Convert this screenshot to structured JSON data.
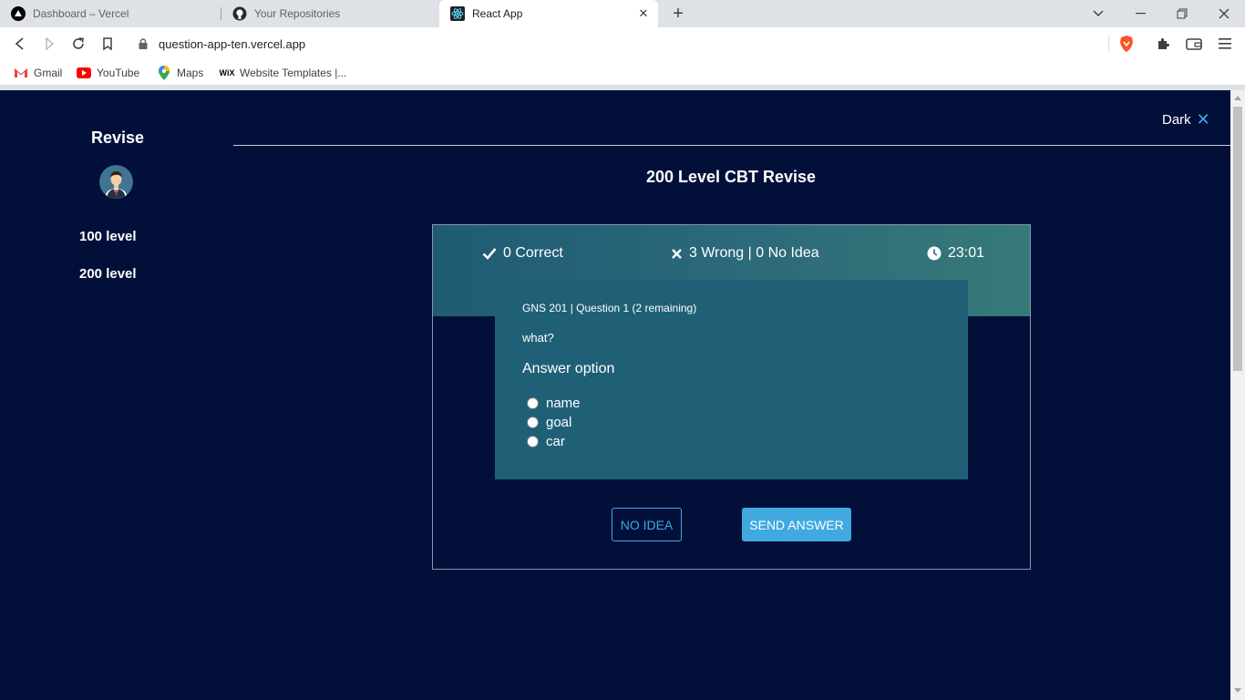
{
  "browser": {
    "tabs": [
      {
        "title": "Dashboard – Vercel",
        "icon": "vercel-icon"
      },
      {
        "title": "Your Repositories",
        "icon": "github-icon"
      },
      {
        "title": "React App",
        "icon": "react-icon",
        "active": true
      }
    ],
    "url": "question-app-ten.vercel.app",
    "bookmarks": [
      {
        "label": "Gmail",
        "icon": "gmail-icon"
      },
      {
        "label": "YouTube",
        "icon": "youtube-icon"
      },
      {
        "label": "Maps",
        "icon": "maps-icon"
      },
      {
        "label": "Website Templates |...",
        "icon": "wix-icon"
      }
    ]
  },
  "sidebar": {
    "brand": "Revise",
    "links": [
      {
        "label": "100 level"
      },
      {
        "label": "200 level"
      }
    ]
  },
  "header": {
    "theme_toggle": "Dark"
  },
  "main": {
    "title": "200 Level CBT Revise",
    "stats": {
      "correct": "0 Correct",
      "wrong": "3 Wrong | 0 No Idea",
      "timer": "23:01"
    },
    "question": {
      "meta": "GNS 201 | Question 1 (2 remaining)",
      "text": "what?",
      "answer_label": "Answer option",
      "options": [
        "name",
        "goal",
        "car"
      ]
    },
    "buttons": {
      "no_idea": "NO IDEA",
      "send": "SEND ANSWER"
    }
  },
  "colors": {
    "page_bg": "#021039",
    "accent": "#3fa9e0",
    "question_bg": "#1f6077"
  }
}
